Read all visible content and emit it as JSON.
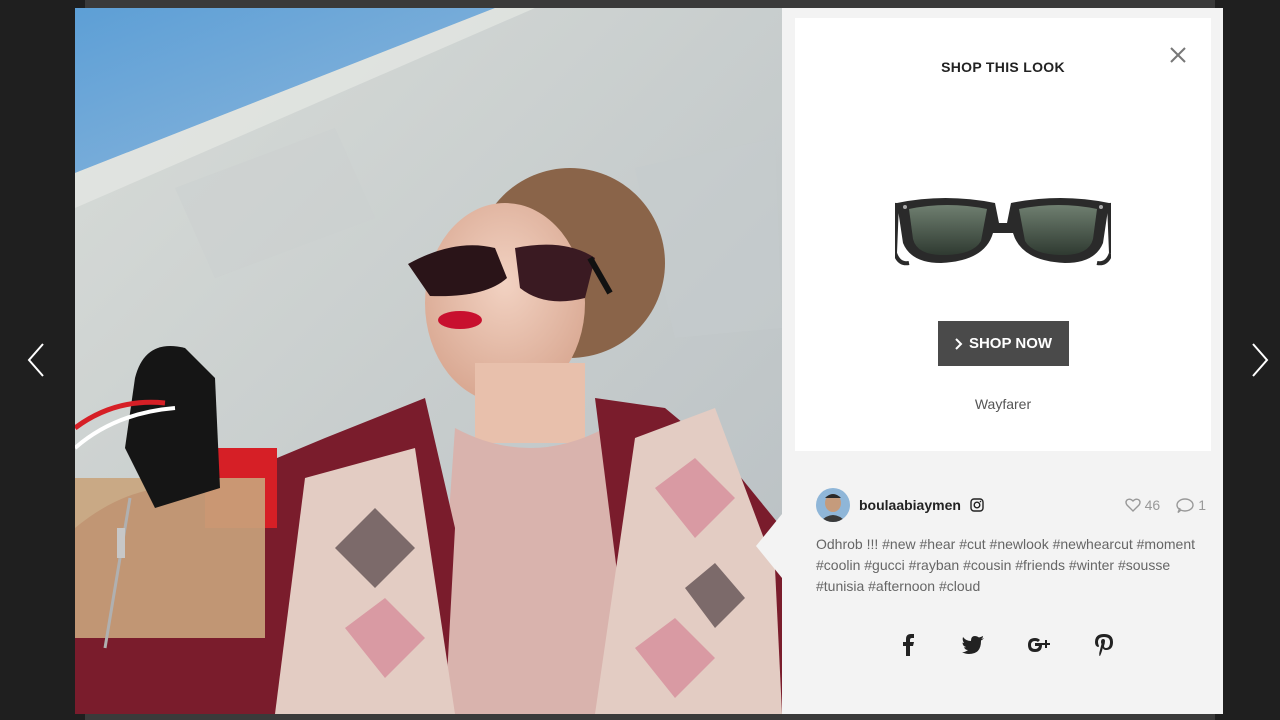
{
  "shop_panel": {
    "title": "SHOP THIS LOOK",
    "shop_button_label": "SHOP NOW",
    "product_name": "Wayfarer"
  },
  "post": {
    "username": "boulaabiaymen",
    "likes": "46",
    "comments": "1",
    "caption": "Odhrob !!! #new #hear #cut #newlook #newhearcut #moment #coolin #gucci #rayban #cousin #friends #winter #sousse #tunisia #afternoon #cloud"
  },
  "icons": {
    "prev": "chevron-left-icon",
    "next": "chevron-right-icon",
    "close": "close-icon",
    "instagram": "instagram-icon",
    "like": "heart-icon",
    "comment": "comment-icon",
    "share": [
      "facebook-icon",
      "twitter-icon",
      "google-plus-icon",
      "pinterest-icon"
    ]
  },
  "colors": {
    "backdrop": "#1f1f1f",
    "panel": "#f3f3f3",
    "card": "#ffffff",
    "button": "#4a4a4a",
    "text": "#222222",
    "muted": "#999999"
  }
}
